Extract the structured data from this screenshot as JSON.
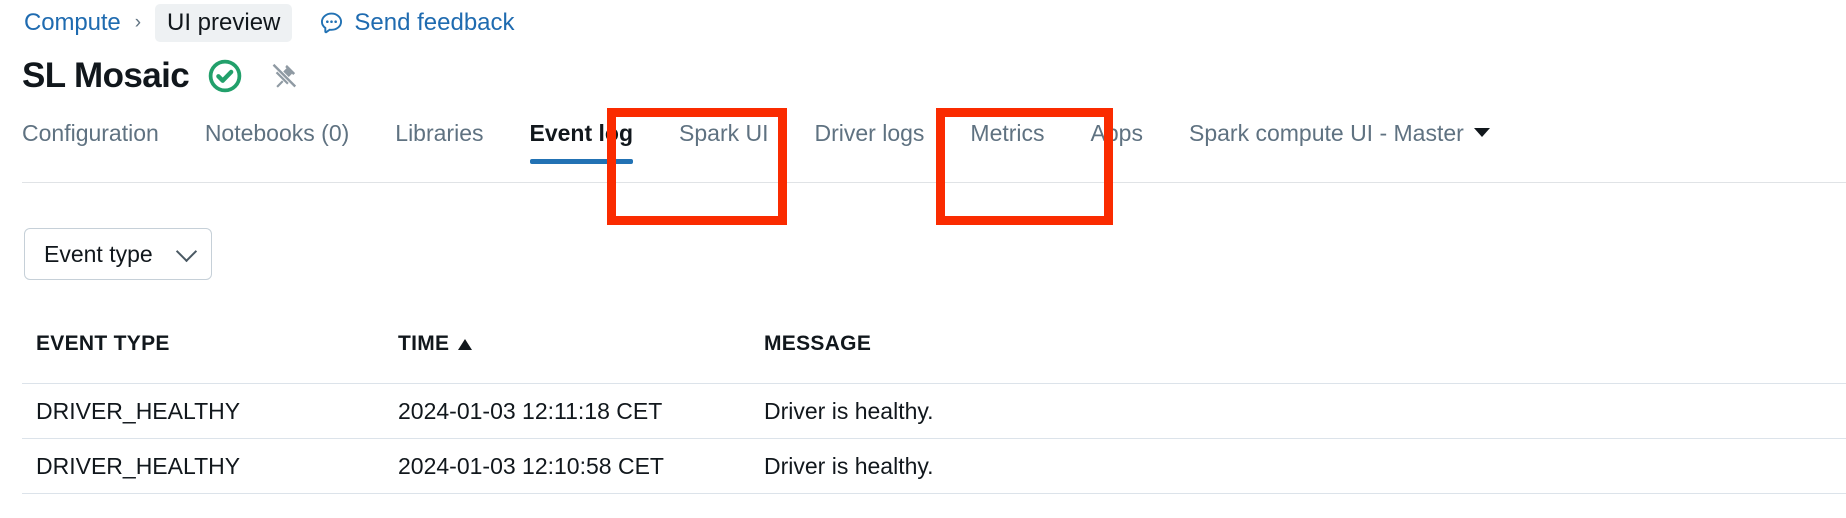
{
  "breadcrumb": {
    "parent": "Compute",
    "separator": "›",
    "current_chip": "UI preview",
    "feedback_label": "Send feedback",
    "feedback_icon": "speech-bubble-icon"
  },
  "header": {
    "title": "SL Mosaic",
    "status_icon": "check-circle-icon",
    "status_color": "#22a06b",
    "pin_icon": "unpin-icon",
    "pin_color": "#8f9aa3"
  },
  "tabs": {
    "items": [
      {
        "label": "Configuration",
        "active": false
      },
      {
        "label": "Notebooks (0)",
        "active": false
      },
      {
        "label": "Libraries",
        "active": false
      },
      {
        "label": "Event log",
        "active": true
      },
      {
        "label": "Spark UI",
        "active": false
      },
      {
        "label": "Driver logs",
        "active": false
      },
      {
        "label": "Metrics",
        "active": false
      },
      {
        "label": "Apps",
        "active": false
      }
    ],
    "dropdown_tab": {
      "label": "Spark compute UI - Master",
      "icon": "caret-down-icon"
    },
    "active_underline_color": "#2272b4"
  },
  "filter": {
    "label": "Event type",
    "icon": "chevron-down-icon"
  },
  "table": {
    "columns": [
      {
        "key": "event_type",
        "label": "EVENT TYPE",
        "sorted": false
      },
      {
        "key": "time",
        "label": "TIME",
        "sorted": true,
        "sort_icon": "sort-ascending-icon"
      },
      {
        "key": "message",
        "label": "MESSAGE",
        "sorted": false
      }
    ],
    "rows": [
      {
        "event_type": "DRIVER_HEALTHY",
        "time": "2024-01-03 12:11:18 CET",
        "message": "Driver is healthy."
      },
      {
        "event_type": "DRIVER_HEALTHY",
        "time": "2024-01-03 12:10:58 CET",
        "message": "Driver is healthy."
      }
    ]
  },
  "annotations": {
    "color": "#fa2b00",
    "boxes": [
      {
        "target": "Event log"
      },
      {
        "target": "Driver logs"
      }
    ]
  }
}
